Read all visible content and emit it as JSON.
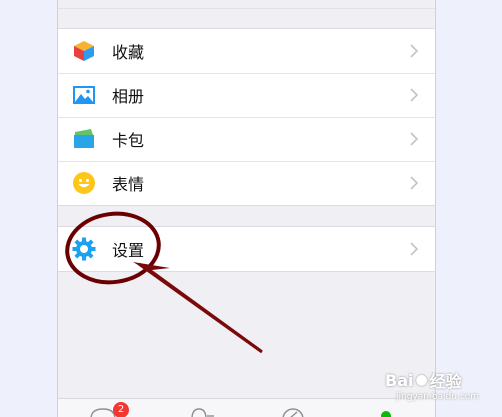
{
  "menu": {
    "group1": [
      {
        "label": "收藏",
        "icon": "favorites-icon"
      },
      {
        "label": "相册",
        "icon": "album-icon"
      },
      {
        "label": "卡包",
        "icon": "card-wallet-icon"
      },
      {
        "label": "表情",
        "icon": "sticker-icon"
      }
    ],
    "group2": [
      {
        "label": "设置",
        "icon": "settings-gear-icon"
      }
    ]
  },
  "tabbar": {
    "chats_badge": "2",
    "tabs": [
      "chats-icon",
      "contacts-icon",
      "discover-icon",
      "me-icon"
    ]
  },
  "annotation": {
    "circle_color": "#6b0000",
    "arrow_color": "#7a0a0a"
  },
  "watermark": {
    "brand": "Bai",
    "brand_suffix": "经验",
    "sub": "jingyan.baidu.com"
  },
  "colors": {
    "accent_blue": "#1aa3f0",
    "badge_red": "#f43530",
    "active_green": "#09bb07"
  }
}
